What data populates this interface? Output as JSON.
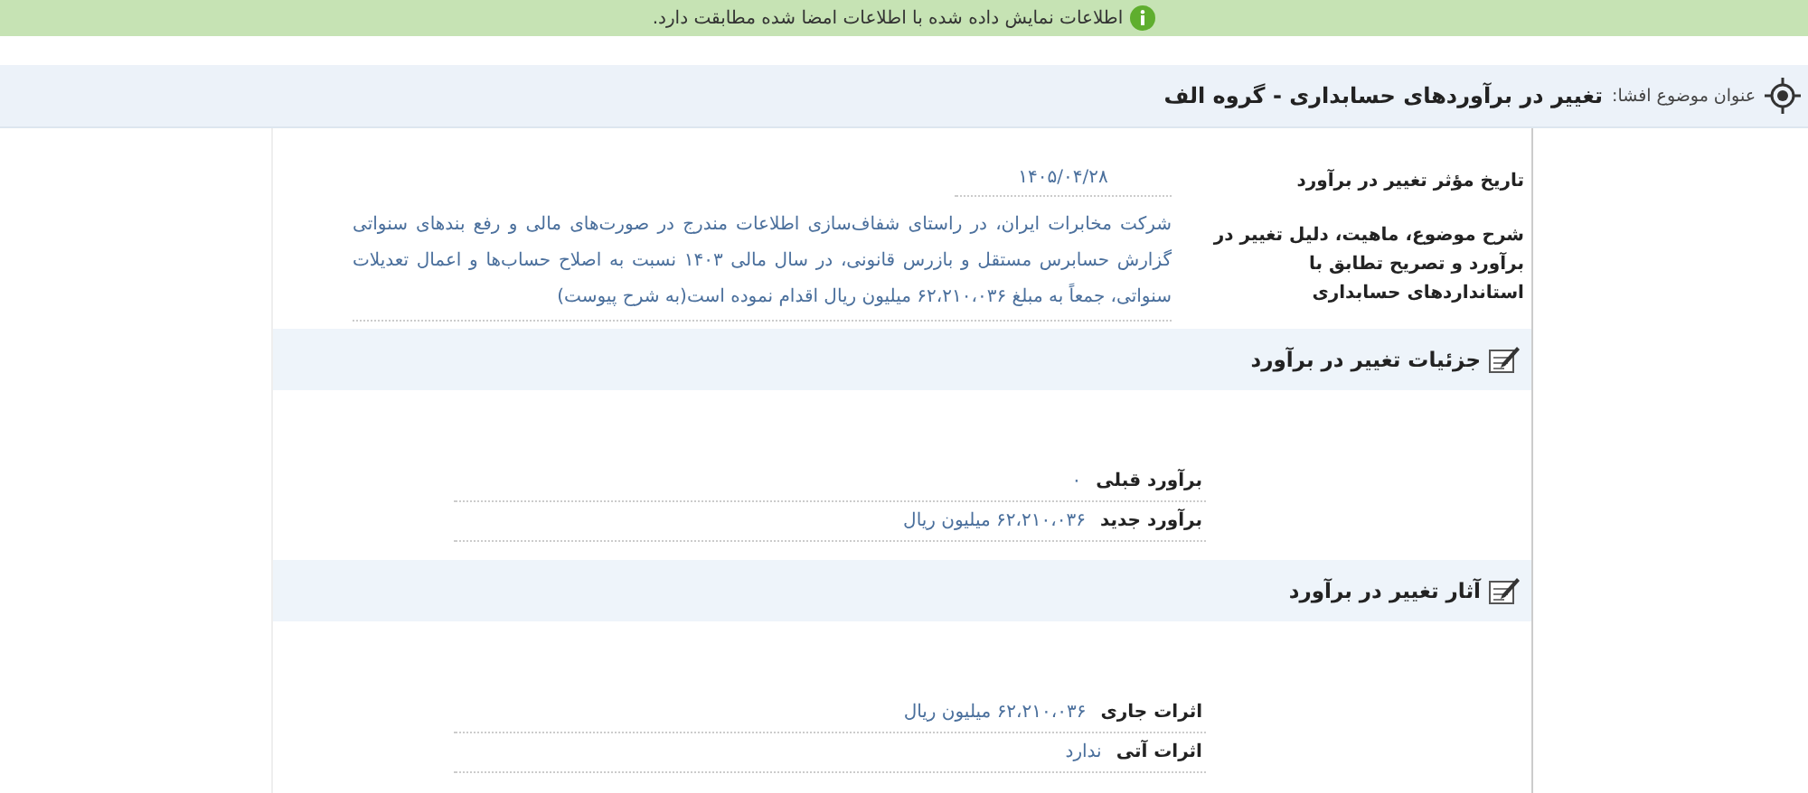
{
  "banner": {
    "text": "اطلاعات نمایش داده شده با اطلاعات امضا شده مطابقت دارد."
  },
  "title": {
    "label": "عنوان موضوع افشا:",
    "value": "تغییر در برآوردهای حسابداری - گروه الف"
  },
  "fields": [
    {
      "label": "تاریخ مؤثر تغییر در برآورد",
      "value": "۱۴۰۵/۰۴/۲۸"
    },
    {
      "label": "شرح موضوع، ماهیت، دلیل تغییر در برآورد و تصریح تطابق با استانداردهای حسابداری",
      "value": "شرکت مخابرات ایران، در راستای شفاف‌سازی اطلاعات مندرج در صورت‌های مالی و رفع بندهای سنواتی گزارش حسابرس مستقل و بازرس قانونی، در سال مالی ۱۴۰۳ نسبت به اصلاح حساب‌ها و اعمال تعدیلات سنواتی، جمعاً به مبلغ ۶۲،۲۱۰،۰۳۶ میلیون ریال اقدام نموده است(به شرح پیوست)"
    }
  ],
  "sections": [
    {
      "title": "جزئیات تغییر در برآورد",
      "rows": [
        {
          "label": "برآورد قبلی",
          "value": "۰"
        },
        {
          "label": "برآورد جدید",
          "value": "۶۲،۲۱۰،۰۳۶ میلیون ریال"
        }
      ]
    },
    {
      "title": "آثار تغییر در برآورد",
      "rows": [
        {
          "label": "اثرات جاری",
          "value": "۶۲،۲۱۰،۰۳۶ میلیون ریال"
        },
        {
          "label": "اثرات آتی",
          "value": "ندارد"
        }
      ]
    }
  ]
}
